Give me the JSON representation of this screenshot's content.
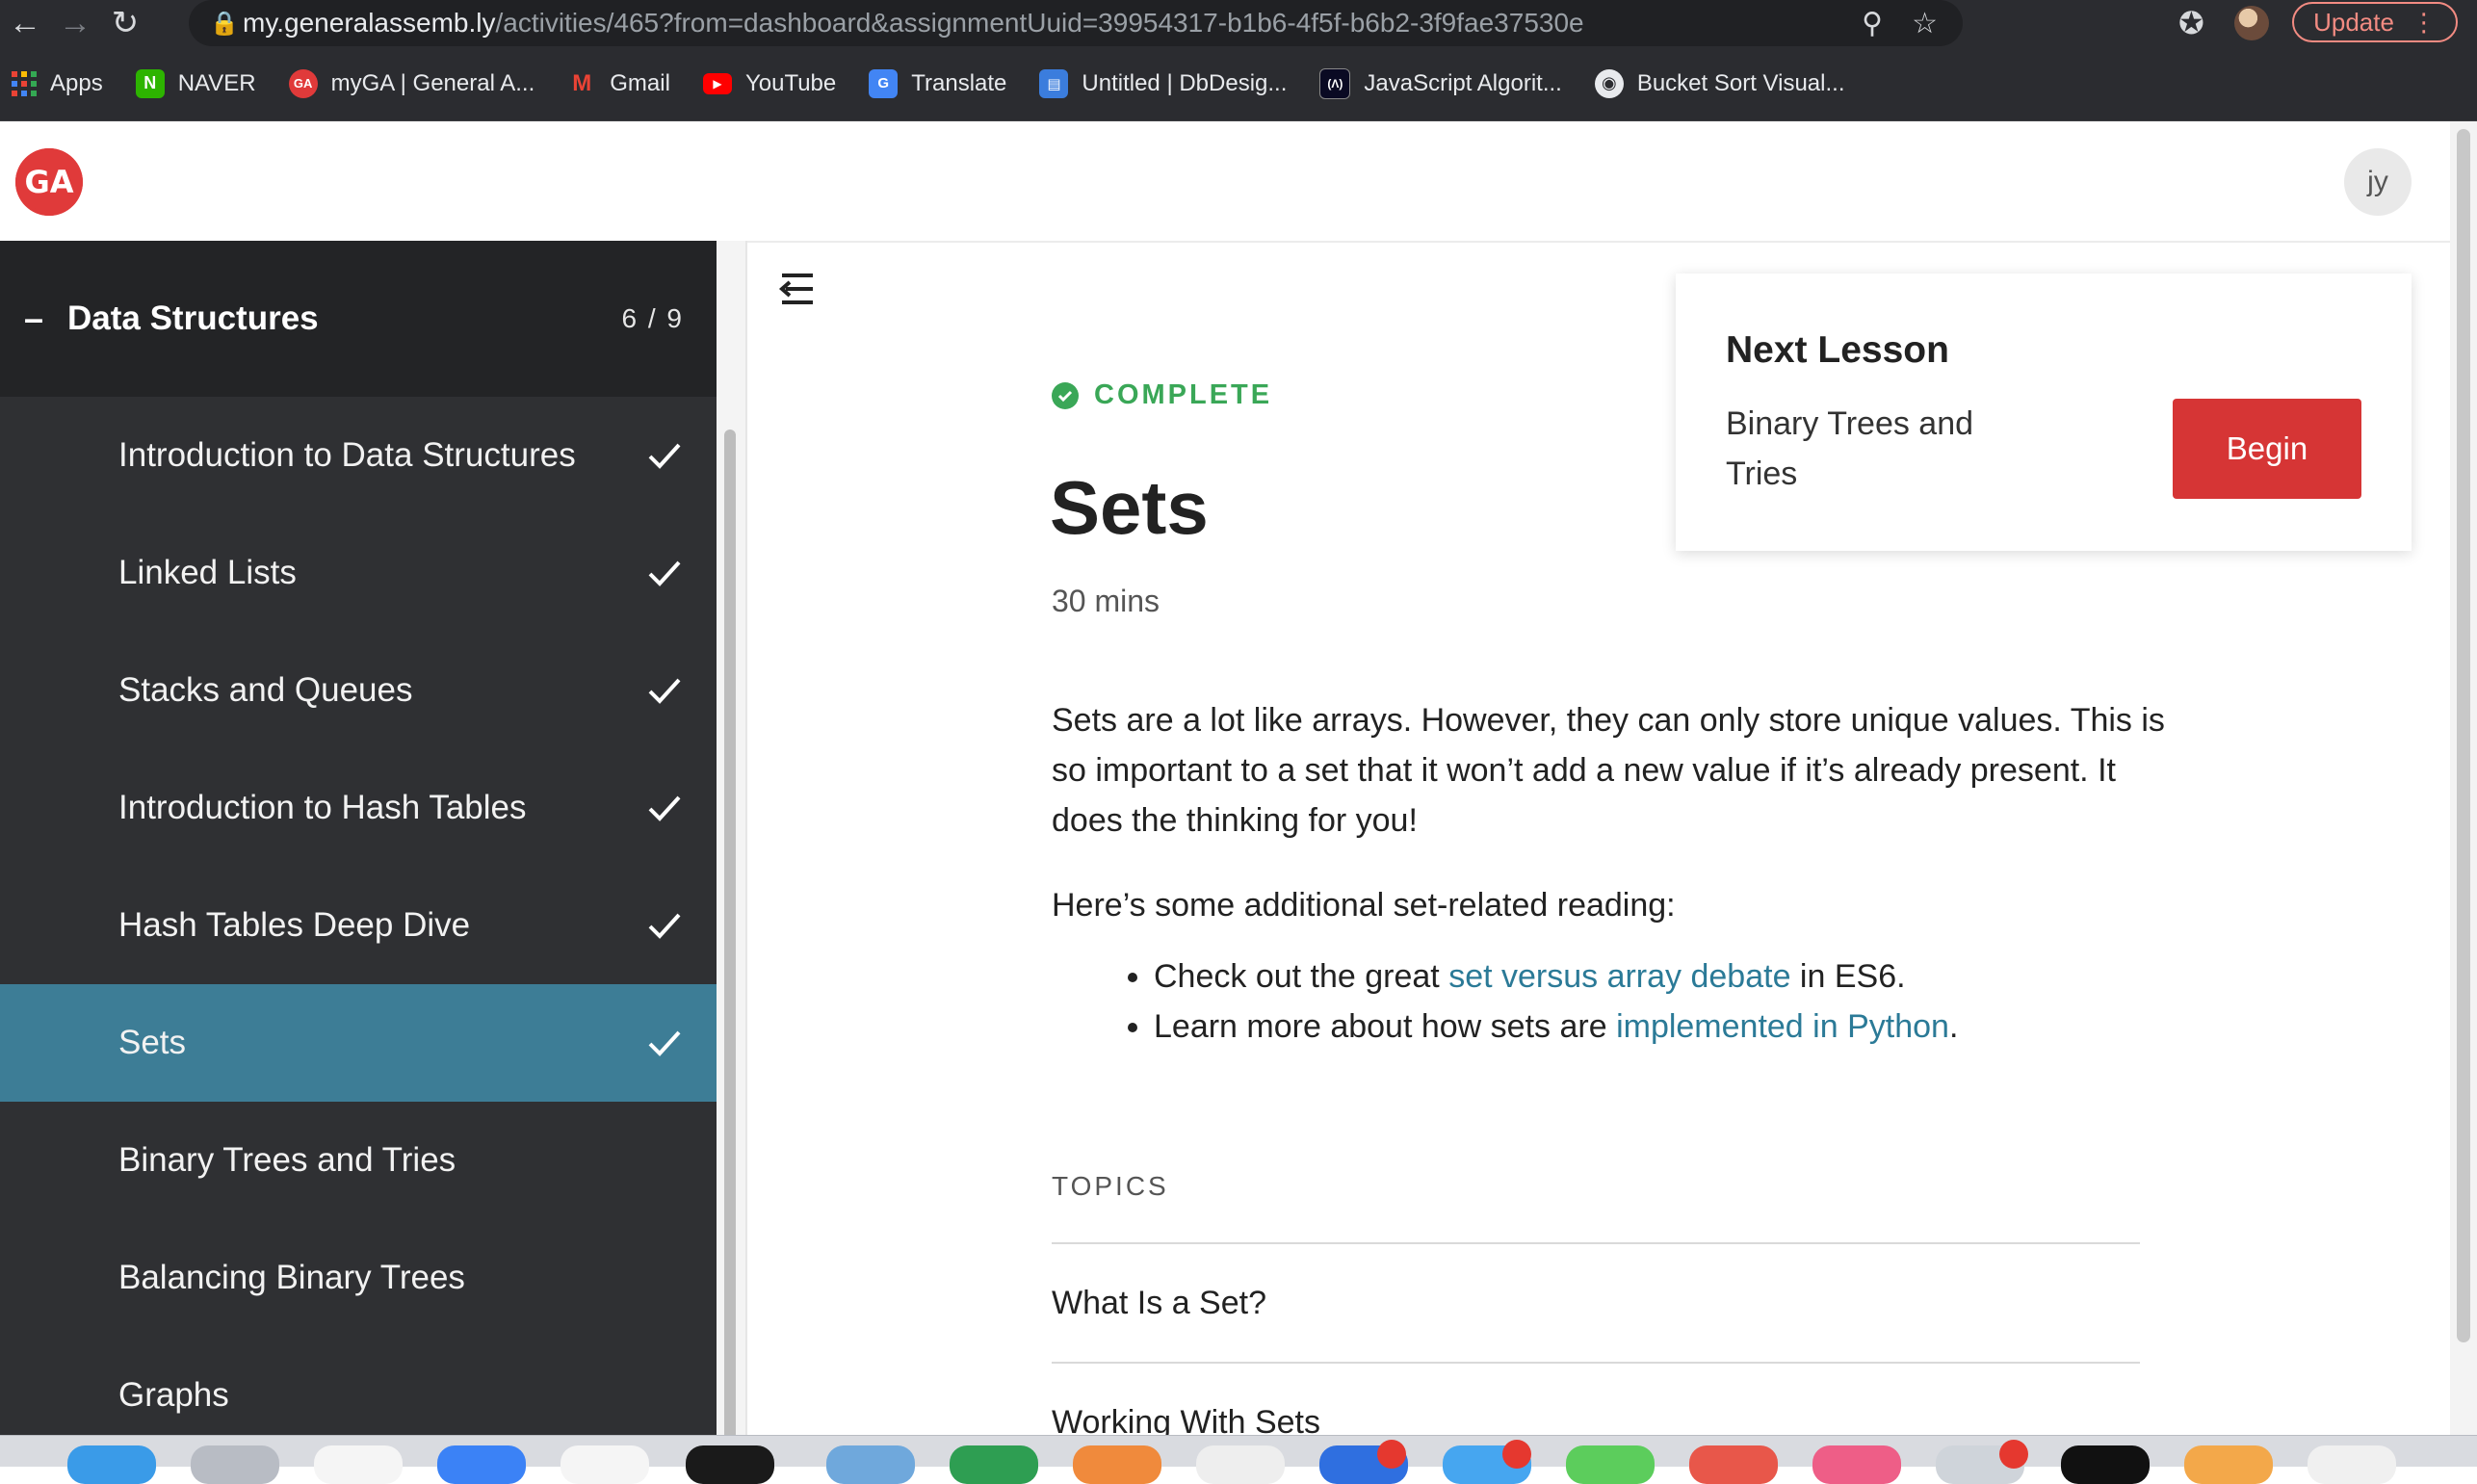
{
  "browser": {
    "url_host": "my.generalassemb.ly",
    "url_path": "/activities/465?from=dashboard&assignmentUuid=39954317-b1b6-4f5f-b6b2-3f9fae37530e",
    "update_label": "Update",
    "bookmarks": [
      {
        "label": "Apps",
        "icon": "apps-grid-icon"
      },
      {
        "label": "NAVER",
        "icon": "naver-icon",
        "color": "#2db400"
      },
      {
        "label": "myGA | General A...",
        "icon": "ga-icon",
        "color": "#e03a3a"
      },
      {
        "label": "Gmail",
        "icon": "gmail-icon",
        "color": "#ea4335"
      },
      {
        "label": "YouTube",
        "icon": "youtube-icon",
        "color": "#ff0000"
      },
      {
        "label": "Translate",
        "icon": "translate-icon",
        "color": "#4285f4"
      },
      {
        "label": "Untitled | DbDesig...",
        "icon": "dbdesigner-icon",
        "color": "#3b7ddd"
      },
      {
        "label": "JavaScript Algorit...",
        "icon": "freecodecamp-icon",
        "color": "#0a0a23"
      },
      {
        "label": "Bucket Sort Visual...",
        "icon": "globe-icon",
        "color": "#e8eaed"
      }
    ]
  },
  "header": {
    "logo_text": "GA",
    "avatar_initials": "jy"
  },
  "sidebar": {
    "section_title": "Data Structures",
    "section_count": "6 / 9",
    "lessons": [
      {
        "label": "Introduction to Data Structures",
        "done": true
      },
      {
        "label": "Linked Lists",
        "done": true
      },
      {
        "label": "Stacks and Queues",
        "done": true
      },
      {
        "label": "Introduction to Hash Tables",
        "done": true
      },
      {
        "label": "Hash Tables Deep Dive",
        "done": true
      },
      {
        "label": "Sets",
        "done": true,
        "active": true
      },
      {
        "label": "Binary Trees and Tries",
        "done": false
      },
      {
        "label": "Balancing Binary Trees",
        "done": false
      },
      {
        "label": "Graphs",
        "done": false
      }
    ]
  },
  "main": {
    "status": "COMPLETE",
    "title": "Sets",
    "duration": "30 mins",
    "intro": "Sets are a lot like arrays. However, they can only store unique values. This is so important to a set that it won’t add a new value if it’s already present. It does the thinking for you!",
    "reading_intro": "Here’s some additional set-related reading:",
    "bullet1_before": "Check out the great ",
    "bullet1_link": "set versus array debate",
    "bullet1_after": " in ES6.",
    "bullet2_before": "Learn more about how sets are ",
    "bullet2_link": "implemented in Python",
    "bullet2_after": ".",
    "topics_label": "TOPICS",
    "topics": [
      "What Is a Set?",
      "Working With Sets"
    ]
  },
  "next_lesson": {
    "heading": "Next Lesson",
    "name": "Binary Trees and Tries",
    "button_label": "Begin"
  },
  "colors": {
    "accent_teal": "#3d7d96",
    "complete_green": "#3aa757",
    "begin_red": "#d63535",
    "link_blue": "#2b7a97"
  }
}
